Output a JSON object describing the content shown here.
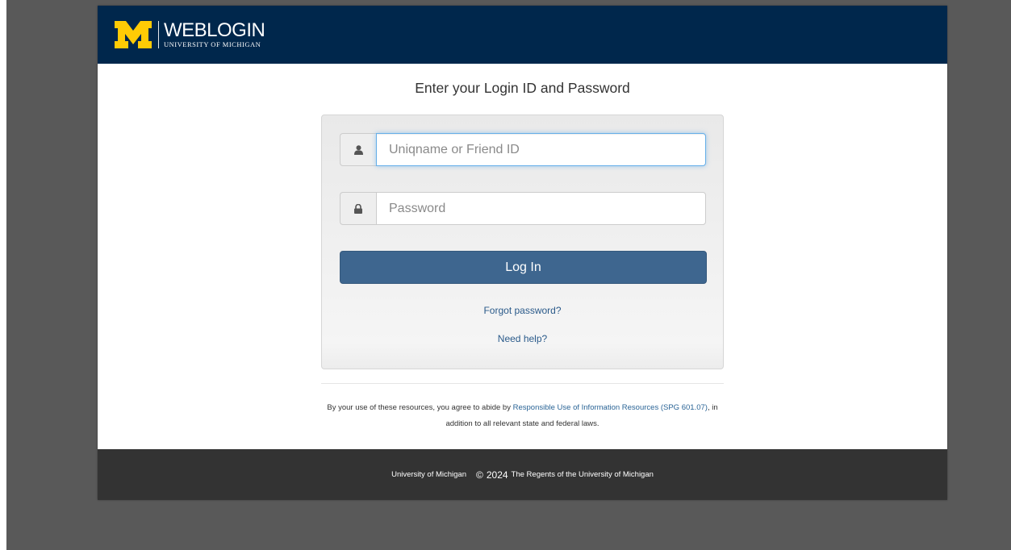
{
  "header": {
    "wordmark": "WEBLOGIN",
    "subtitle": "UNIVERSITY OF MICHIGAN",
    "colors": {
      "navy": "#00274c",
      "maize": "#ffcb05"
    }
  },
  "page_title": "Enter your Login ID and Password",
  "login": {
    "username": {
      "value": "",
      "placeholder": "Uniqname or Friend ID",
      "icon": "user-icon"
    },
    "password": {
      "value": "",
      "placeholder": "Password",
      "icon": "lock-icon"
    },
    "submit_label": "Log In",
    "forgot_label": "Forgot password?",
    "help_label": "Need help?",
    "button_color": "#3e668f"
  },
  "disclaimer": {
    "before": "By your use of these resources, you agree to abide by ",
    "link_text": "Responsible Use of Information Resources (SPG 601.07)",
    "after": ", in addition to all relevant state and federal laws."
  },
  "footer": {
    "org": "University of Michigan",
    "copyright_symbol": "©",
    "year": "2024",
    "rights": "The Regents of the University of Michigan"
  }
}
